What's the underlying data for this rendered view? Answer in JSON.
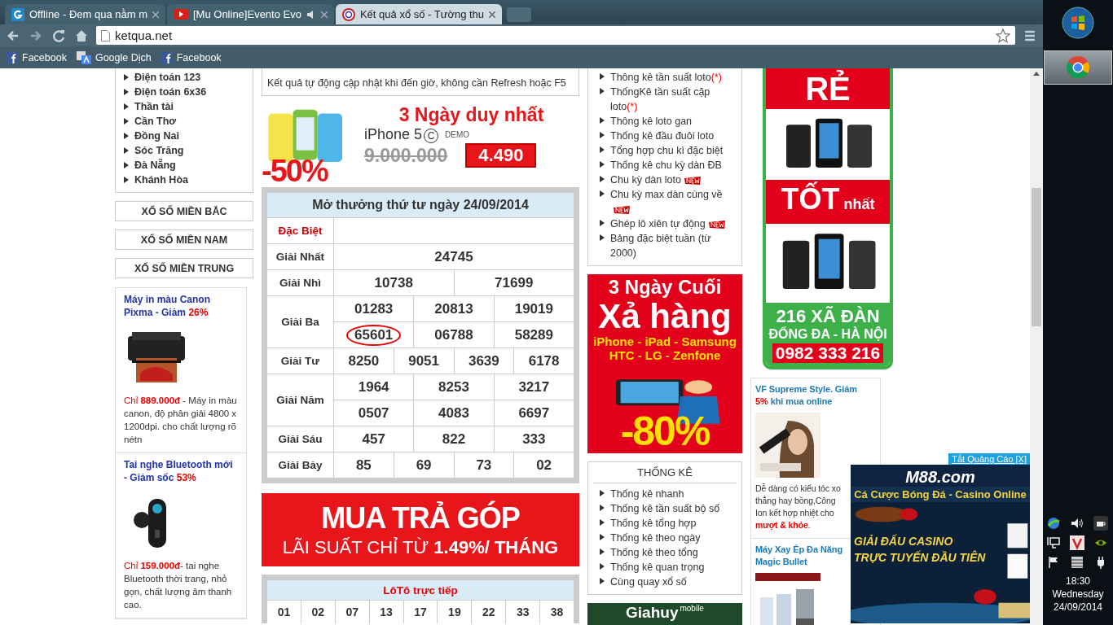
{
  "browser": {
    "tabs": [
      {
        "title": "Offline - Đem qua nằm m",
        "selected": false,
        "audio": false
      },
      {
        "title": "[Mu Online]Evento Evo",
        "selected": false,
        "audio": true
      },
      {
        "title": "Kết quả xổ số - Tường thu",
        "selected": true,
        "audio": false
      }
    ],
    "address": "ketqua.net",
    "bookmarks": [
      {
        "label": "Facebook"
      },
      {
        "label": "Google Dịch"
      },
      {
        "label": "Facebook"
      }
    ]
  },
  "left": {
    "provinces": [
      "Điện toán 123",
      "Điện toán 6x36",
      "Thần tài",
      "Cần Thơ",
      "Đồng Nai",
      "Sóc Trăng",
      "Đà Nẵng",
      "Khánh Hòa"
    ],
    "region_buttons": [
      "XỔ SỐ MIỀN BẮC",
      "XỔ SỐ MIỀN NAM",
      "XỔ SỐ MIỀN TRUNG"
    ],
    "products": [
      {
        "title": "Máy in màu Canon Pixma - Giảm",
        "discount": "26%",
        "prefix": "Chỉ",
        "price": "889.000đ",
        "desc": " - Máy in màu canon, độ phân giải 4800 x 1200dpi. cho chất lượng rõ nétn"
      },
      {
        "title": "Tai nghe Bluetooth mới - Giảm sốc",
        "discount": "53%",
        "prefix": "Chỉ",
        "price": "159.000đ",
        "desc": "- tai nghe Bluetooth thời trang, nhỏ gọn, chất lượng âm thanh cao."
      }
    ]
  },
  "middle": {
    "notice": "Kết quả tự động cập nhật khi đến giờ, không cần Refresh hoặc F5",
    "promo": {
      "headline": "3 Ngày duy nhất",
      "model": "iPhone 5",
      "model_mark": "C",
      "demo": "DEMO",
      "discount": "-50%",
      "old_price": "9.000.000",
      "new_price": "4.490"
    },
    "results": {
      "title": "Mở thưởng thứ tư ngày 24/09/2014",
      "rows": [
        {
          "prize": "Đặc Biệt",
          "kind": "special",
          "lines": []
        },
        {
          "prize": "Giải Nhất",
          "kind": "normal",
          "lines": [
            [
              {
                "n": "24745",
                "circled": false
              }
            ]
          ]
        },
        {
          "prize": "Giải Nhì",
          "kind": "normal",
          "lines": [
            [
              {
                "n": "10738",
                "circled": false
              },
              {
                "n": "71699",
                "circled": false
              }
            ]
          ]
        },
        {
          "prize": "Giải Ba",
          "kind": "normal",
          "lines": [
            [
              {
                "n": "01283",
                "circled": false
              },
              {
                "n": "20813",
                "circled": false
              },
              {
                "n": "19019",
                "circled": false
              }
            ],
            [
              {
                "n": "65601",
                "circled": true
              },
              {
                "n": "06788",
                "circled": false
              },
              {
                "n": "58289",
                "circled": false
              }
            ]
          ]
        },
        {
          "prize": "Giải Tư",
          "kind": "normal",
          "lines": [
            [
              {
                "n": "8250",
                "circled": false
              },
              {
                "n": "9051",
                "circled": false
              },
              {
                "n": "3639",
                "circled": false
              },
              {
                "n": "6178",
                "circled": false
              }
            ]
          ]
        },
        {
          "prize": "Giải Năm",
          "kind": "normal",
          "lines": [
            [
              {
                "n": "1964",
                "circled": false
              },
              {
                "n": "8253",
                "circled": false
              },
              {
                "n": "3217",
                "circled": false
              }
            ],
            [
              {
                "n": "0507",
                "circled": false
              },
              {
                "n": "4083",
                "circled": false
              },
              {
                "n": "6697",
                "circled": false
              }
            ]
          ]
        },
        {
          "prize": "Giải Sáu",
          "kind": "normal",
          "lines": [
            [
              {
                "n": "457",
                "circled": false
              },
              {
                "n": "822",
                "circled": false
              },
              {
                "n": "333",
                "circled": false
              }
            ]
          ]
        },
        {
          "prize": "Giải Bảy",
          "kind": "normal",
          "lines": [
            [
              {
                "n": "85",
                "circled": false
              },
              {
                "n": "69",
                "circled": false
              },
              {
                "n": "73",
                "circled": false
              },
              {
                "n": "02",
                "circled": false
              }
            ]
          ]
        }
      ]
    },
    "banner": {
      "line1": "MUA TRẢ GÓP",
      "line2": "LÃI SUẤT CHỈ TỪ **1.49%/ THÁNG**"
    },
    "loto": {
      "title": "LôTô trực tiếp",
      "numbers": [
        "01",
        "02",
        "07",
        "13",
        "17",
        "19",
        "22",
        "33",
        "38"
      ]
    }
  },
  "right": {
    "links": [
      {
        "label": "Thông kê tần suất loto",
        "suffix": "(*)",
        "new": false
      },
      {
        "label": "ThốngKê tần suất cặp loto",
        "suffix": "(*)",
        "new": false
      },
      {
        "label": "Thông kê loto gan",
        "new": false
      },
      {
        "label": "Thống kê đầu đuôi loto",
        "new": false
      },
      {
        "label": "Tổng hợp chu kì đặc biệt",
        "new": false
      },
      {
        "label": "Thống kê chu kỳ dàn ĐB",
        "new": false
      },
      {
        "label": "Chu kỳ dàn loto",
        "new": true
      },
      {
        "label": "Chu kỳ max dàn cùng về",
        "new": true
      },
      {
        "label": "Ghép lô xiên tự động",
        "new": true
      },
      {
        "label": "Bảng đặc biệt tuần (từ 2000)",
        "new": false
      }
    ],
    "sale_ad": {
      "line1": "3 Ngày Cuối",
      "line2": "Xả hàng",
      "line3": "iPhone - iPad - Samsung",
      "line4": "HTC - LG - Zenfone",
      "discount": "-80%"
    },
    "stats": {
      "title": "THỐNG KÊ",
      "items": [
        "Thống kê nhanh",
        "Thống kê tần suất bộ số",
        "Thống kê tổng hợp",
        "Thống kê theo ngày",
        "Thống kê theo tổng",
        "Thống kê quan trọng",
        "Cùng quay xổ số"
      ]
    },
    "store_banner": {
      "brand": "Giahuy",
      "tag": "mobile"
    },
    "store_ad": {
      "top": "RẺ",
      "middle": "TỐT",
      "middle_small": "nhất",
      "address1": "216 XÃ ĐÀN",
      "address2": "ĐỐNG ĐA - HÀ NỘI",
      "phone": "0982 333 216"
    },
    "products": [
      {
        "title": "VF Supreme Style. Giảm",
        "discount": "5%",
        "title_end": "khi mua online",
        "desc": [
          "Dễ dàng có kiểu tóc xo",
          "thẳng hay bồng,Công",
          "Ion kết hợp nhiệt cho"
        ],
        "highlight": "mượt & khỏe",
        "tail": "."
      },
      {
        "title": "Máy Xay Ép Đa Năng",
        "title_end": "Magic Bullet"
      }
    ]
  },
  "overlay_ad": {
    "close": "Tắt Quảng Cáo [X]",
    "brand": "M88.com",
    "tagline": "Cá Cược Bóng Đá - Casino Online",
    "headline1": "GIẢI ĐẤU CASINO",
    "headline2": "TRỰC TUYẾN ĐẦU TIÊN"
  },
  "taskbar": {
    "apps": [
      {
        "active": true
      }
    ],
    "clock": {
      "time": "18:30",
      "day": "Wednesday",
      "date": "24/09/2014"
    }
  }
}
